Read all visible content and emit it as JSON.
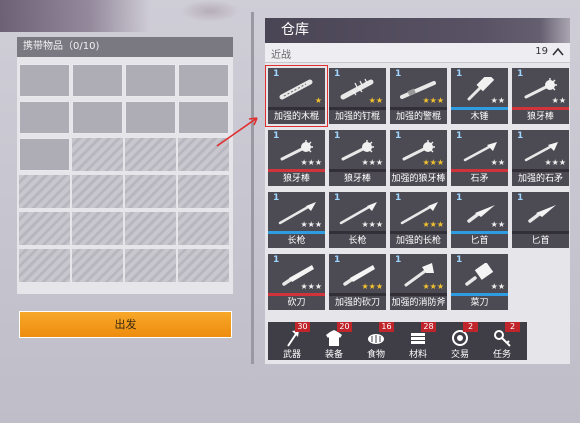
{
  "carry": {
    "title": "携带物品（0/10)",
    "open_slots": 9,
    "total_slots": 24
  },
  "depart_label": "出发",
  "warehouse": {
    "title": "仓库",
    "section": {
      "name": "近战",
      "count": "19"
    },
    "items": [
      {
        "name": "加强的木棍",
        "qty": "1",
        "stars": 1,
        "star_color": "gold",
        "bar": "gray",
        "icon": "bat-icon"
      },
      {
        "name": "加强的钉棍",
        "qty": "1",
        "stars": 2,
        "star_color": "gold",
        "bar": "gray",
        "icon": "nail-bat-icon"
      },
      {
        "name": "加强的警棍",
        "qty": "1",
        "stars": 3,
        "star_color": "gold",
        "bar": "gray",
        "icon": "baton-icon"
      },
      {
        "name": "木锤",
        "qty": "1",
        "stars": 2,
        "star_color": "white",
        "bar": "blue",
        "icon": "hammer-icon"
      },
      {
        "name": "狼牙棒",
        "qty": "1",
        "stars": 2,
        "star_color": "white",
        "bar": "red",
        "icon": "mace-icon"
      },
      {
        "name": "狼牙棒",
        "qty": "1",
        "stars": 3,
        "star_color": "white",
        "bar": "red",
        "icon": "mace-icon"
      },
      {
        "name": "狼牙棒",
        "qty": "1",
        "stars": 3,
        "star_color": "white",
        "bar": "gray",
        "icon": "mace-icon"
      },
      {
        "name": "加强的狼牙棒",
        "qty": "1",
        "stars": 3,
        "star_color": "gold",
        "bar": "gray",
        "icon": "mace-icon"
      },
      {
        "name": "石矛",
        "qty": "1",
        "stars": 2,
        "star_color": "white",
        "bar": "red",
        "icon": "stone-spear-icon"
      },
      {
        "name": "加强的石矛",
        "qty": "1",
        "stars": 3,
        "star_color": "white",
        "bar": "gray",
        "icon": "stone-spear-icon"
      },
      {
        "name": "长枪",
        "qty": "1",
        "stars": 3,
        "star_color": "white",
        "bar": "blue",
        "icon": "spear-icon"
      },
      {
        "name": "长枪",
        "qty": "1",
        "stars": 3,
        "star_color": "white",
        "bar": "gray",
        "icon": "spear-icon"
      },
      {
        "name": "加强的长枪",
        "qty": "1",
        "stars": 3,
        "star_color": "gold",
        "bar": "gray",
        "icon": "spear-icon"
      },
      {
        "name": "匕首",
        "qty": "1",
        "stars": 2,
        "star_color": "white",
        "bar": "blue",
        "icon": "dagger-icon"
      },
      {
        "name": "匕首",
        "qty": "1",
        "stars": 0,
        "star_color": "white",
        "bar": "gray",
        "icon": "dagger-icon"
      },
      {
        "name": "砍刀",
        "qty": "1",
        "stars": 3,
        "star_color": "white",
        "bar": "red",
        "icon": "machete-icon"
      },
      {
        "name": "加强的砍刀",
        "qty": "1",
        "stars": 3,
        "star_color": "gold",
        "bar": "gray",
        "icon": "machete-icon"
      },
      {
        "name": "加强的消防斧",
        "qty": "1",
        "stars": 3,
        "star_color": "gold",
        "bar": "gray",
        "icon": "fire-axe-icon"
      },
      {
        "name": "菜刀",
        "qty": "1",
        "stars": 2,
        "star_color": "white",
        "bar": "blue",
        "icon": "cleaver-icon"
      }
    ]
  },
  "tabs": [
    {
      "label": "武器",
      "count": "30",
      "icon": "axe-icon"
    },
    {
      "label": "装备",
      "count": "20",
      "icon": "shirt-icon"
    },
    {
      "label": "食物",
      "count": "16",
      "icon": "bread-icon"
    },
    {
      "label": "材料",
      "count": "28",
      "icon": "wood-icon"
    },
    {
      "label": "交易",
      "count": "2",
      "icon": "coin-icon"
    },
    {
      "label": "任务",
      "count": "2",
      "icon": "key-icon"
    }
  ],
  "colors": {
    "accent": "#f39a1c",
    "highlight": "#e03030",
    "bar_blue": "#2f9be0",
    "bar_red": "#d0333a"
  }
}
